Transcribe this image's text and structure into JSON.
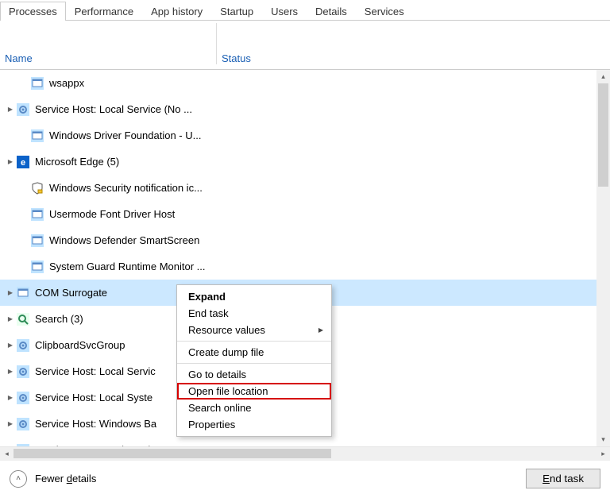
{
  "tabs": {
    "items": [
      {
        "label": "Processes",
        "active": true
      },
      {
        "label": "Performance",
        "active": false
      },
      {
        "label": "App history",
        "active": false
      },
      {
        "label": "Startup",
        "active": false
      },
      {
        "label": "Users",
        "active": false
      },
      {
        "label": "Details",
        "active": false
      },
      {
        "label": "Services",
        "active": false
      }
    ]
  },
  "columns": {
    "name": "Name",
    "status": "Status"
  },
  "processes": [
    {
      "expandable": false,
      "indent": 1,
      "icon": "app-icon",
      "label": "wsappx"
    },
    {
      "expandable": true,
      "indent": 0,
      "icon": "gear-icon",
      "label": "Service Host: Local Service (No ..."
    },
    {
      "expandable": false,
      "indent": 1,
      "icon": "app-icon",
      "label": "Windows Driver Foundation - U..."
    },
    {
      "expandable": true,
      "indent": 0,
      "icon": "edge-icon",
      "label": "Microsoft Edge (5)"
    },
    {
      "expandable": false,
      "indent": 1,
      "icon": "shield-icon",
      "label": "Windows Security notification ic..."
    },
    {
      "expandable": false,
      "indent": 1,
      "icon": "app-icon",
      "label": "Usermode Font Driver Host"
    },
    {
      "expandable": false,
      "indent": 1,
      "icon": "app-icon",
      "label": "Windows Defender SmartScreen"
    },
    {
      "expandable": false,
      "indent": 1,
      "icon": "app-icon",
      "label": "System Guard Runtime Monitor ..."
    },
    {
      "expandable": true,
      "indent": 0,
      "icon": "app-icon",
      "label": "COM Surrogate",
      "selected": true
    },
    {
      "expandable": true,
      "indent": 0,
      "icon": "search-icon",
      "label": "Search (3)"
    },
    {
      "expandable": true,
      "indent": 0,
      "icon": "gear-icon",
      "label": "ClipboardSvcGroup"
    },
    {
      "expandable": true,
      "indent": 0,
      "icon": "gear-icon",
      "label": "Service Host: Local Servic"
    },
    {
      "expandable": true,
      "indent": 0,
      "icon": "gear-icon",
      "label": "Service Host: Local Syste"
    },
    {
      "expandable": true,
      "indent": 0,
      "icon": "gear-icon",
      "label": "Service Host: Windows Ba"
    },
    {
      "expandable": true,
      "indent": 0,
      "icon": "gear-icon",
      "label": "Service Host: Local Servic"
    }
  ],
  "context_menu": {
    "items": [
      {
        "label": "Expand",
        "bold": true
      },
      {
        "label": "End task"
      },
      {
        "label": "Resource values",
        "submenu": true
      },
      {
        "sep": true
      },
      {
        "label": "Create dump file"
      },
      {
        "sep": true
      },
      {
        "label": "Go to details"
      },
      {
        "label": "Open file location",
        "highlight": true
      },
      {
        "label": "Search online"
      },
      {
        "label": "Properties"
      }
    ]
  },
  "footer": {
    "fewer_details": "Fewer details",
    "fewer_details_letter": "d",
    "end_task": "End task",
    "end_task_letter": "E"
  }
}
